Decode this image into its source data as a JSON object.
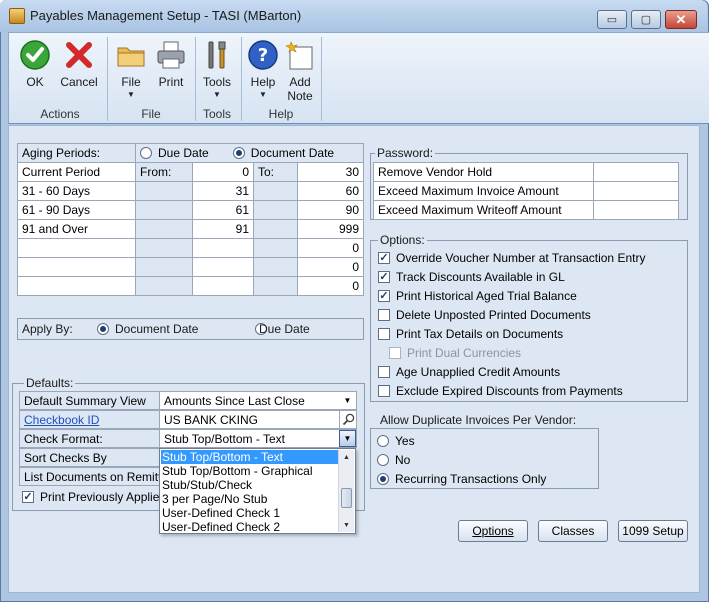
{
  "window": {
    "title": "Payables Management Setup  -  TASI (MBarton)",
    "minimize_glyph": "▭",
    "maximize_glyph": "▢",
    "close_glyph": "✕"
  },
  "ribbon": {
    "buttons": {
      "ok": "OK",
      "cancel": "Cancel",
      "file": "File",
      "print": "Print",
      "tools": "Tools",
      "help": "Help",
      "add_note_1": "Add",
      "add_note_2": "Note"
    },
    "groups": {
      "actions": "Actions",
      "file": "File",
      "tools": "Tools",
      "help": "Help"
    },
    "icons": [
      "checkmark-icon",
      "x-icon",
      "folder-icon",
      "printer-icon",
      "tools-icon",
      "help-question-icon",
      "note-icon"
    ]
  },
  "aging": {
    "label": "Aging Periods:",
    "due_date": "Due Date",
    "document_date": "Document Date",
    "selected": "document_date",
    "from_label": "From:",
    "to_label": "To:",
    "rows": [
      {
        "name": "Current Period",
        "from": "0",
        "to": "30"
      },
      {
        "name": "31 - 60 Days",
        "from": "31",
        "to": "60"
      },
      {
        "name": "61 - 90 Days",
        "from": "61",
        "to": "90"
      },
      {
        "name": "91 and Over",
        "from": "91",
        "to": "999"
      },
      {
        "name": "",
        "from": "",
        "to": "0"
      },
      {
        "name": "",
        "from": "",
        "to": "0"
      },
      {
        "name": "",
        "from": "",
        "to": "0"
      }
    ]
  },
  "apply_by": {
    "label": "Apply By:",
    "document_date": "Document Date",
    "due_date": "Due Date",
    "selected": "document_date"
  },
  "defaults": {
    "label": "Defaults:",
    "summary_view_label": "Default Summary View",
    "summary_view_value": "Amounts Since Last Close",
    "checkbook_label": "Checkbook ID",
    "checkbook_value": "US BANK CKING",
    "check_format_label": "Check Format:",
    "check_format_value": "Stub Top/Bottom - Text",
    "sort_checks_label": "Sort Checks By",
    "list_docs_label": "List Documents on Remittan",
    "print_applied_label": "Print Previously Applied D",
    "print_applied_checked": true
  },
  "check_format_options": [
    "Stub Top/Bottom - Text",
    "Stub Top/Bottom - Graphical",
    "Stub/Stub/Check",
    "3 per Page/No Stub",
    "User-Defined Check 1",
    "User-Defined Check 2"
  ],
  "password": {
    "label": "Password:",
    "items": [
      "Remove Vendor Hold",
      "Exceed Maximum Invoice Amount",
      "Exceed Maximum Writeoff Amount"
    ]
  },
  "options": {
    "label": "Options:",
    "items": [
      {
        "label": "Override Voucher Number at Transaction Entry",
        "checked": true,
        "enabled": true
      },
      {
        "label": "Track Discounts  Available in GL",
        "checked": true,
        "enabled": true
      },
      {
        "label": "Print Historical  Aged Trial Balance",
        "checked": true,
        "enabled": true
      },
      {
        "label": "Delete Unposted Printed Documents",
        "checked": false,
        "enabled": true
      },
      {
        "label": "Print Tax Details on Documents",
        "checked": false,
        "enabled": true
      },
      {
        "label": "Print Dual Currencies",
        "checked": false,
        "enabled": false
      },
      {
        "label": "Age Unapplied Credit Amounts",
        "checked": false,
        "enabled": true
      },
      {
        "label": "Exclude Expired Discounts from Payments",
        "checked": false,
        "enabled": true
      }
    ]
  },
  "duplicates": {
    "label": "Allow Duplicate Invoices Per Vendor:",
    "yes": "Yes",
    "no": "No",
    "recurring": "Recurring Transactions Only",
    "selected": "recurring"
  },
  "buttons": {
    "options": "Options",
    "classes": "Classes",
    "setup_1099": "1099 Setup"
  },
  "colors": {
    "form_bg": "#dde7f3",
    "selection": "#3399ff",
    "title_bg": "#a9c3e2"
  }
}
